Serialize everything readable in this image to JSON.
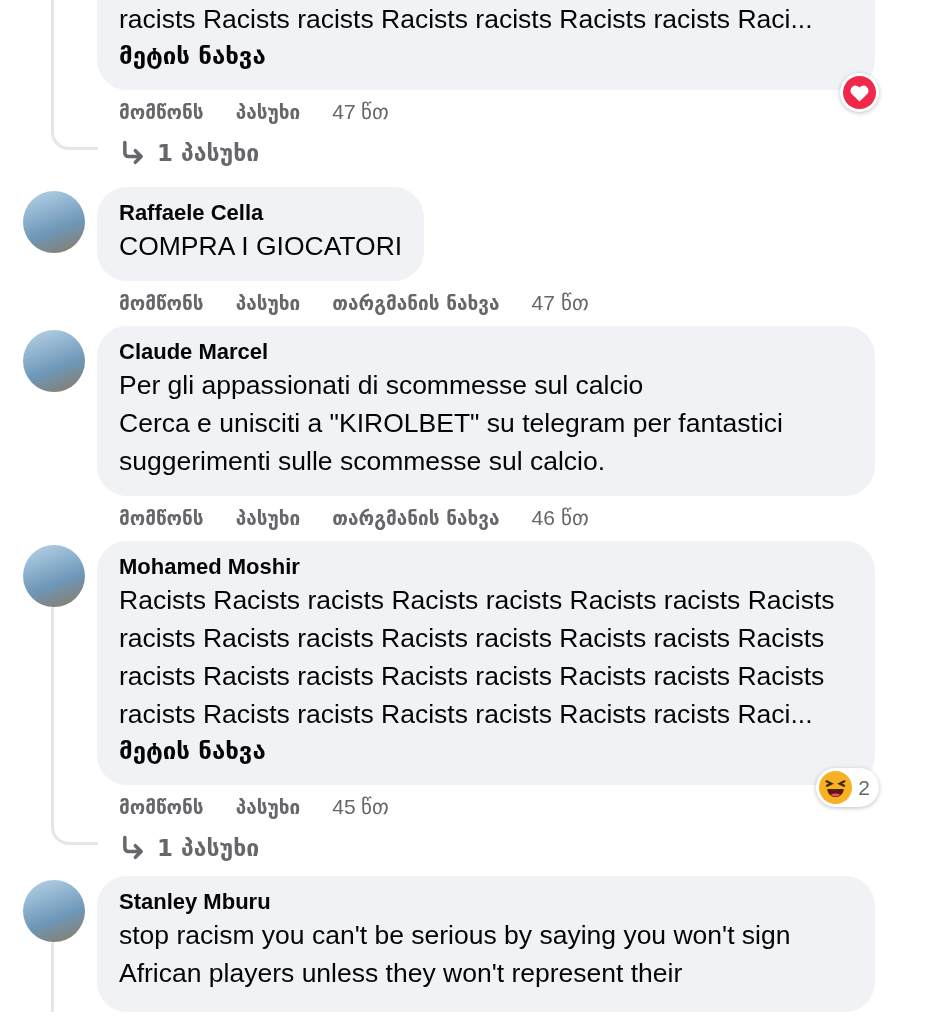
{
  "comments": [
    {
      "body": "racists Racists racists Racists racists Racists racists Raci...",
      "see_more": "მეტის ნახვა",
      "actions": {
        "like": "მომწონს",
        "reply": "პასუხი",
        "time": "47 წთ"
      },
      "reaction": {
        "kind": "heart"
      },
      "replies": "1 პასუხი",
      "thread_line": true
    },
    {
      "author": "Raffaele Cella",
      "body": "COMPRA I GIOCATORI",
      "actions": {
        "like": "მომწონს",
        "reply": "პასუხი",
        "translate": "თარგმანის ნახვა",
        "time": "47 წთ"
      },
      "thread_line": false
    },
    {
      "author": "Claude Marcel",
      "body": "Per gli appassionati di scommesse sul calcio\nCerca e unisciti a \"KIROLBET\" su telegram per fantastici\nsuggerimenti sulle scommesse sul calcio.",
      "actions": {
        "like": "მომწონს",
        "reply": "პასუხი",
        "translate": "თარგმანის ნახვა",
        "time": "46 წთ"
      },
      "thread_line": false
    },
    {
      "author": "Mohamed Moshir",
      "body": "Racists Racists racists Racists racists Racists racists Racists\nracists Racists racists Racists racists Racists racists Racists\nracists Racists racists Racists racists Racists racists Racists\nracists Racists racists Racists racists Racists racists Raci...",
      "see_more": "მეტის ნახვა",
      "actions": {
        "like": "მომწონს",
        "reply": "პასუხი",
        "time": "45 წთ"
      },
      "reaction": {
        "kind": "laugh",
        "count": "2"
      },
      "replies": "1 პასუხი",
      "thread_line": true
    },
    {
      "author": "Stanley Mburu",
      "body": "stop racism you can't be serious by saying you won't sign\nAfrican players unless they won't represent their",
      "thread_line": true
    }
  ]
}
